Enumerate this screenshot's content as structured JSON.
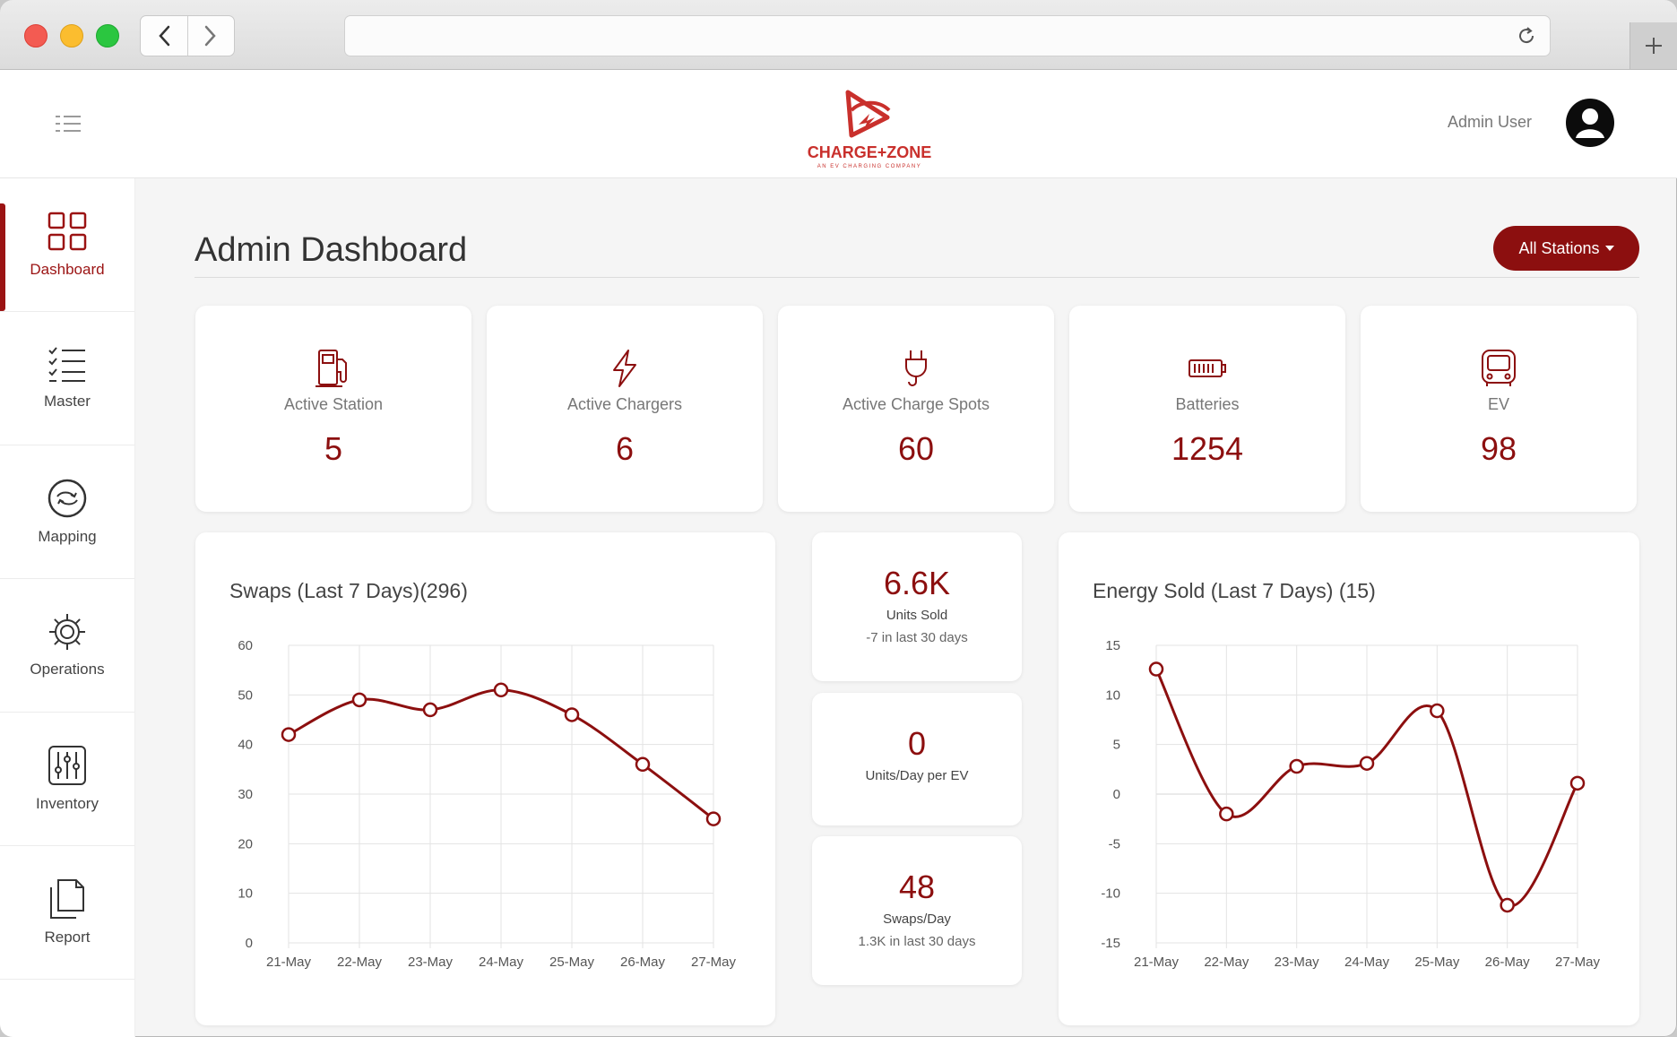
{
  "browser": {
    "url": ""
  },
  "header": {
    "logo_text": "CHARGE+ZONE",
    "logo_tagline": "AN EV CHARGING COMPANY",
    "user_name": "Admin User"
  },
  "sidebar": {
    "items": [
      {
        "label": "Dashboard",
        "icon": "grid-icon",
        "active": true
      },
      {
        "label": "Master",
        "icon": "checklist-icon",
        "active": false
      },
      {
        "label": "Mapping",
        "icon": "swap-icon",
        "active": false
      },
      {
        "label": "Operations",
        "icon": "gear-icon",
        "active": false
      },
      {
        "label": "Inventory",
        "icon": "sliders-icon",
        "active": false
      },
      {
        "label": "Report",
        "icon": "document-icon",
        "active": false
      }
    ]
  },
  "page": {
    "title": "Admin Dashboard",
    "filter_button": "All Stations"
  },
  "stats": [
    {
      "label": "Active Station",
      "value": "5",
      "icon": "fuel-station-icon"
    },
    {
      "label": "Active Chargers",
      "value": "6",
      "icon": "lightning-icon"
    },
    {
      "label": "Active Charge Spots",
      "value": "60",
      "icon": "plug-icon"
    },
    {
      "label": "Batteries",
      "value": "1254",
      "icon": "battery-icon"
    },
    {
      "label": "EV",
      "value": "98",
      "icon": "vehicle-icon"
    }
  ],
  "minis": [
    {
      "value": "6.6K",
      "label": "Units Sold",
      "sub": "-7 in last 30 days"
    },
    {
      "value": "0",
      "label": "Units/Day per EV",
      "sub": ""
    },
    {
      "value": "48",
      "label": "Swaps/Day",
      "sub": "1.3K in last 30 days"
    }
  ],
  "colors": {
    "brand": "#8c0f0f",
    "grid": "#e3e3e3"
  },
  "chart_data": [
    {
      "type": "line",
      "title": "Swaps (Last 7 Days)(296)",
      "categories": [
        "21-May",
        "22-May",
        "23-May",
        "24-May",
        "25-May",
        "26-May",
        "27-May"
      ],
      "values": [
        42,
        49,
        47,
        51,
        46,
        36,
        25
      ],
      "yticks": [
        0,
        10,
        20,
        30,
        40,
        50,
        60
      ],
      "ylim": [
        0,
        60
      ],
      "grid": true
    },
    {
      "type": "line",
      "title": "Energy Sold (Last 7 Days) (15)",
      "categories": [
        "21-May",
        "22-May",
        "23-May",
        "24-May",
        "25-May",
        "26-May",
        "27-May"
      ],
      "values": [
        12.6,
        -2,
        2.8,
        3.1,
        8.4,
        -11.2,
        1.1
      ],
      "yticks": [
        15,
        10,
        5,
        0,
        -5,
        -10,
        -15
      ],
      "ylim": [
        -15,
        15
      ],
      "grid": true
    }
  ]
}
